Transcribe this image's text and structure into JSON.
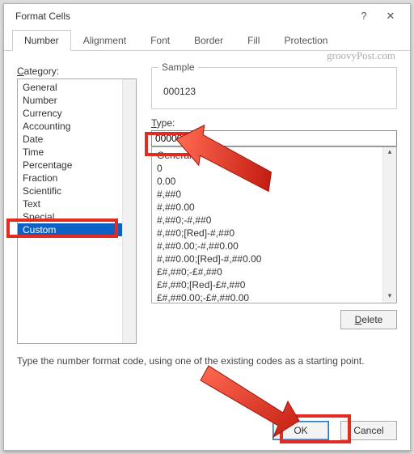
{
  "dialog": {
    "title": "Format Cells",
    "watermark": "groovyPost.com"
  },
  "tabs": {
    "items": [
      {
        "label": "Number",
        "active": true
      },
      {
        "label": "Alignment",
        "active": false
      },
      {
        "label": "Font",
        "active": false
      },
      {
        "label": "Border",
        "active": false
      },
      {
        "label": "Fill",
        "active": false
      },
      {
        "label": "Protection",
        "active": false
      }
    ]
  },
  "category": {
    "label_prefix": "C",
    "label_rest": "ategory:",
    "items": [
      {
        "label": "General",
        "selected": false
      },
      {
        "label": "Number",
        "selected": false
      },
      {
        "label": "Currency",
        "selected": false
      },
      {
        "label": "Accounting",
        "selected": false
      },
      {
        "label": "Date",
        "selected": false
      },
      {
        "label": "Time",
        "selected": false
      },
      {
        "label": "Percentage",
        "selected": false
      },
      {
        "label": "Fraction",
        "selected": false
      },
      {
        "label": "Scientific",
        "selected": false
      },
      {
        "label": "Text",
        "selected": false
      },
      {
        "label": "Special",
        "selected": false
      },
      {
        "label": "Custom",
        "selected": true
      }
    ]
  },
  "sample": {
    "label": "Sample",
    "value": "000123"
  },
  "type": {
    "label_prefix": "T",
    "label_rest": "ype:",
    "value": "000000"
  },
  "formats": {
    "items": [
      "General",
      "0",
      "0.00",
      "#,##0",
      "#,##0.00",
      "#,##0;-#,##0",
      "#,##0;[Red]-#,##0",
      "#,##0.00;-#,##0.00",
      "#,##0.00;[Red]-#,##0.00",
      "£#,##0;-£#,##0",
      "£#,##0;[Red]-£#,##0",
      "£#,##0.00;-£#,##0.00"
    ]
  },
  "buttons": {
    "delete_prefix": "D",
    "delete_rest": "elete",
    "ok": "OK",
    "cancel": "Cancel"
  },
  "hint": "Type the number format code, using one of the existing codes as a starting point."
}
